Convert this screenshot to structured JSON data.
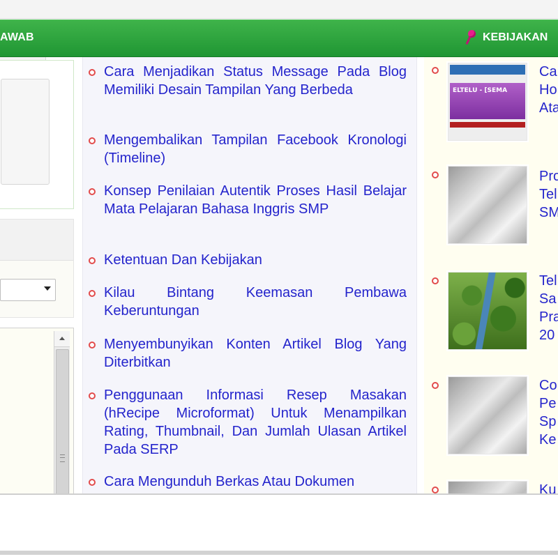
{
  "navbar": {
    "left_text": "AWAB",
    "right_text": "KEBIJAKAN"
  },
  "middle_list": [
    {
      "text": "Cara Menjadikan Status Message Pada Blog Memiliki Desain Tampilan Yang Berbeda"
    },
    {
      "text": "Mengembalikan Tampilan Facebook Kronologi (Timeline)"
    },
    {
      "text": "Konsep Penilaian Autentik Proses Hasil Belajar Mata Pelajaran Bahasa Inggris SMP"
    },
    {
      "text": "Ketentuan Dan Kebijakan"
    },
    {
      "text": "Kilau Bintang Keemasan Pembawa Keberuntungan"
    },
    {
      "text": "Menyembunyikan Konten Artikel Blog Yang Diterbitkan"
    },
    {
      "text": "Penggunaan Informasi Resep Masakan (hRecipe Microformat) Untuk Menampilkan Rating, Thumbnail, Dan Jumlah Ulasan Artikel Pada SERP"
    },
    {
      "text": "Cara Mengunduh Berkas Atau Dokumen"
    }
  ],
  "right_list": [
    {
      "text": "Ca\nHo\nAta",
      "thumb": "site-screenshot",
      "thumb_text": "ELTELU - [SEMA"
    },
    {
      "text": "Pro\nTel\nSM",
      "thumb": "blank-placeholder"
    },
    {
      "text": "Tel\nSa\nPra\n20",
      "thumb": "plant-photo"
    },
    {
      "text": "Co\nPe\nSp\nKe",
      "thumb": "blank-placeholder"
    },
    {
      "text": "Ku",
      "thumb": "blank-placeholder"
    }
  ],
  "colors": {
    "nav_green": "#2aa33d",
    "link": "#2424cc",
    "bullet": "#e24b4b",
    "pin": "#e91e8c"
  }
}
